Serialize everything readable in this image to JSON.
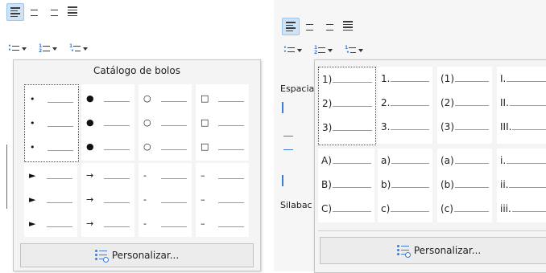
{
  "left": {
    "gallery_title": "Catálogo de bolos",
    "bullet_rows": [
      [
        "•",
        "●",
        "○",
        "□"
      ],
      [
        "•",
        "●",
        "○",
        "□"
      ],
      [
        "•",
        "●",
        "○",
        "□"
      ],
      [
        "►",
        "→",
        "-",
        "–"
      ],
      [
        "►",
        "→",
        "-",
        "–"
      ],
      [
        "►",
        "→",
        "-",
        "–"
      ]
    ],
    "customize_label": "Personalizar..."
  },
  "right": {
    "side_labels": [
      "Espacia",
      "Silabac"
    ],
    "numbering": [
      [
        "1)",
        "1.",
        "(1)",
        "I."
      ],
      [
        "2)",
        "2.",
        "(2)",
        "II."
      ],
      [
        "3)",
        "3.",
        "(3)",
        "III."
      ],
      [
        "A)",
        "a)",
        "(a)",
        "i."
      ],
      [
        "B)",
        "b)",
        "(b)",
        "ii."
      ],
      [
        "C)",
        "c)",
        "(c)",
        "iii."
      ]
    ],
    "customize_label": "Personalizar..."
  },
  "icons": [
    "align-left-icon",
    "align-center-icon",
    "align-right-icon",
    "justify-icon",
    "unordered-list-icon",
    "ordered-list-icon",
    "outline-list-icon",
    "gear-icon"
  ]
}
